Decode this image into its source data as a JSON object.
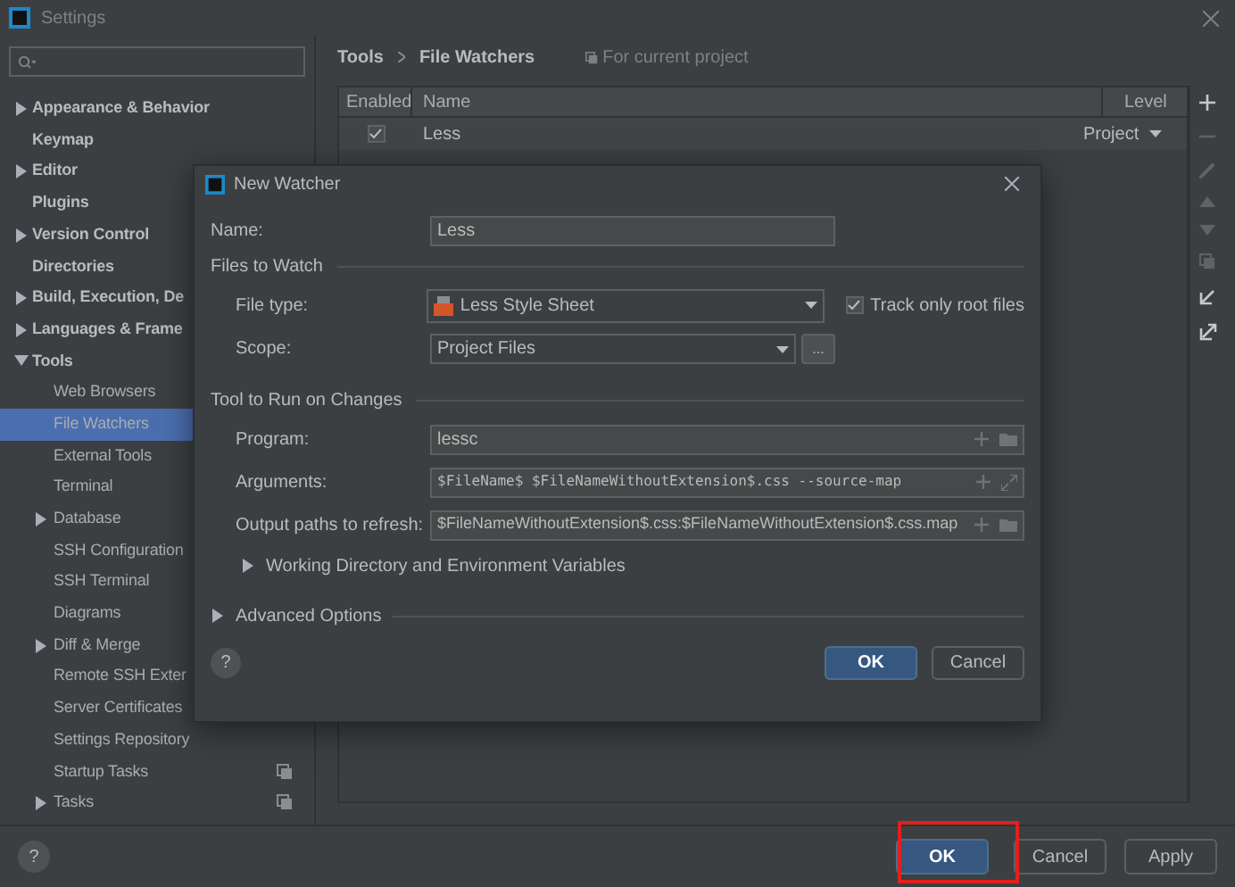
{
  "window": {
    "title": "Settings"
  },
  "sidebar": {
    "items": [
      {
        "label": "Appearance & Behavior",
        "kind": "group",
        "expanded": false,
        "selected": false
      },
      {
        "label": "Keymap",
        "kind": "page",
        "selected": false
      },
      {
        "label": "Editor",
        "kind": "group",
        "expanded": false,
        "selected": false
      },
      {
        "label": "Plugins",
        "kind": "page",
        "selected": false
      },
      {
        "label": "Version Control",
        "kind": "group",
        "expanded": false,
        "selected": false
      },
      {
        "label": "Directories",
        "kind": "page",
        "selected": false
      },
      {
        "label": "Build, Execution, De",
        "kind": "group",
        "expanded": false,
        "selected": false
      },
      {
        "label": "Languages & Frame",
        "kind": "group",
        "expanded": false,
        "selected": false
      },
      {
        "label": "Tools",
        "kind": "group",
        "expanded": true,
        "selected": false,
        "children": [
          {
            "label": "Web Browsers",
            "kind": "page",
            "selected": false
          },
          {
            "label": "File Watchers",
            "kind": "page",
            "selected": true
          },
          {
            "label": "External Tools",
            "kind": "page",
            "selected": false
          },
          {
            "label": "Terminal",
            "kind": "page",
            "selected": false
          },
          {
            "label": "Database",
            "kind": "group",
            "expanded": false,
            "selected": false
          },
          {
            "label": "SSH Configuration",
            "kind": "page",
            "selected": false
          },
          {
            "label": "SSH Terminal",
            "kind": "page",
            "selected": false
          },
          {
            "label": "Diagrams",
            "kind": "page",
            "selected": false
          },
          {
            "label": "Diff & Merge",
            "kind": "group",
            "expanded": false,
            "selected": false
          },
          {
            "label": "Remote SSH Exter",
            "kind": "page",
            "selected": false
          },
          {
            "label": "Server Certificates",
            "kind": "page",
            "selected": false
          },
          {
            "label": "Settings Repository",
            "kind": "page",
            "selected": false
          },
          {
            "label": "Startup Tasks",
            "kind": "page",
            "selected": false,
            "project_level": true
          },
          {
            "label": "Tasks",
            "kind": "group",
            "expanded": false,
            "selected": false,
            "project_level": true
          }
        ]
      }
    ]
  },
  "breadcrumb": [
    "Tools",
    "File Watchers"
  ],
  "scope_note": "For current project",
  "table": {
    "columns": [
      "Enabled",
      "Name",
      "Level"
    ],
    "rows": [
      {
        "enabled": true,
        "name": "Less",
        "level": "Project"
      }
    ]
  },
  "dialog": {
    "title": "New Watcher",
    "name": {
      "label": "Name:",
      "value": "Less"
    },
    "files_to_watch": {
      "heading": "Files to Watch",
      "file_type": {
        "label": "File type:",
        "value": "Less Style Sheet"
      },
      "track_root": {
        "label": "Track only root files",
        "checked": true
      },
      "scope": {
        "label": "Scope:",
        "value": "Project Files",
        "more": "..."
      }
    },
    "tool": {
      "heading": "Tool to Run on Changes",
      "program": {
        "label": "Program:",
        "value": "lessc"
      },
      "arguments": {
        "label": "Arguments:",
        "value": "$FileName$ $FileNameWithoutExtension$.css --source-map"
      },
      "output": {
        "label": "Output paths to refresh:",
        "value": "$FileNameWithoutExtension$.css:$FileNameWithoutExtension$.css.map"
      },
      "working_dir": {
        "label": "Working Directory and Environment Variables",
        "expanded": false
      }
    },
    "advanced": {
      "label": "Advanced Options",
      "expanded": false
    },
    "help": "?",
    "buttons": [
      "OK",
      "Cancel"
    ]
  },
  "footer": {
    "help": "?",
    "buttons": [
      "OK",
      "Cancel",
      "Apply"
    ]
  }
}
